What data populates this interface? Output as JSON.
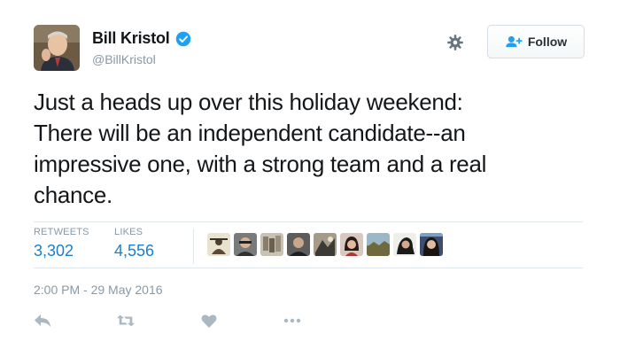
{
  "user": {
    "name": "Bill Kristol",
    "handle": "@BillKristol",
    "verified": true
  },
  "header": {
    "settings_icon": "gear-icon",
    "follow_label": "Follow"
  },
  "tweet": {
    "text_lines": [
      "Just a heads up over this holiday weekend:",
      "There will be an independent candidate--an",
      "impressive one, with a strong team and a real",
      "chance."
    ],
    "retweets_label": "RETWEETS",
    "retweets": "3,302",
    "likes_label": "LIKES",
    "likes": "4,556",
    "timestamp": "2:00 PM - 29 May 2016"
  },
  "likers_count_shown": 9,
  "actions": [
    "reply-icon",
    "retweet-icon",
    "like-icon",
    "more-icon"
  ],
  "colors": {
    "accent": "#1da1f2",
    "count": "#1b7fc9",
    "muted": "#8899a6",
    "action": "#aab8c2"
  }
}
